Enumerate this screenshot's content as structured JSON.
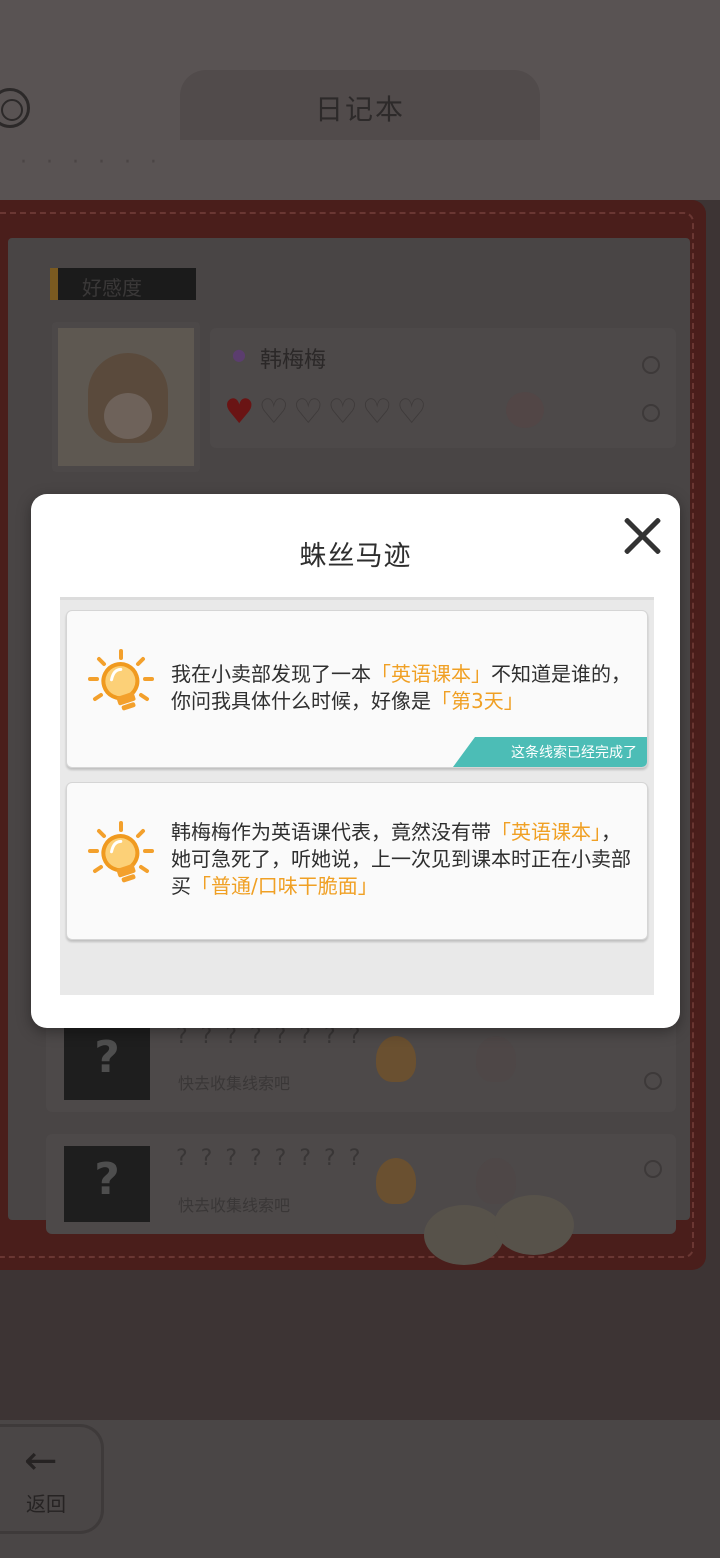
{
  "diary": {
    "title": "日记本",
    "subtitle": "· · · · · ·",
    "section_label": "好感度",
    "character": {
      "name": "韩梅梅",
      "hearts_filled": 1,
      "hearts_total": 6,
      "hearts_text_filled": "♥",
      "hearts_text_empty": "♡♡♡♡♡"
    },
    "clue_rows": [
      {
        "mystery": "? ? ? ? ? ? ? ?",
        "hint": "快去收集线索吧",
        "thumb": "?"
      },
      {
        "mystery": "? ? ? ? ? ? ? ?",
        "hint": "快去收集线索吧",
        "thumb": "?"
      }
    ]
  },
  "modal": {
    "title": "蛛丝马迹",
    "close_icon": "close-icon",
    "clues": [
      {
        "icon": "lightbulb-icon",
        "parts": [
          "我在小卖部发现了一本",
          "「英语课本」",
          "不知道是谁的，你问我具体什么时候，好像是",
          "「第3天」"
        ],
        "status": "这条线索已经完成了"
      },
      {
        "icon": "lightbulb-icon",
        "parts": [
          "韩梅梅作为英语课代表，竟然没有带",
          "「英语课本」",
          "，她可急死了，听她说，上一次见到课本时正在小卖部买",
          "「普通/口味干脆面」"
        ]
      }
    ]
  },
  "navigation": {
    "back_label": "返回",
    "back_icon": "arrow-left-icon"
  },
  "colors": {
    "highlight": "#f0a024",
    "badge": "#4cbdb6",
    "board": "#4a1e1b"
  }
}
